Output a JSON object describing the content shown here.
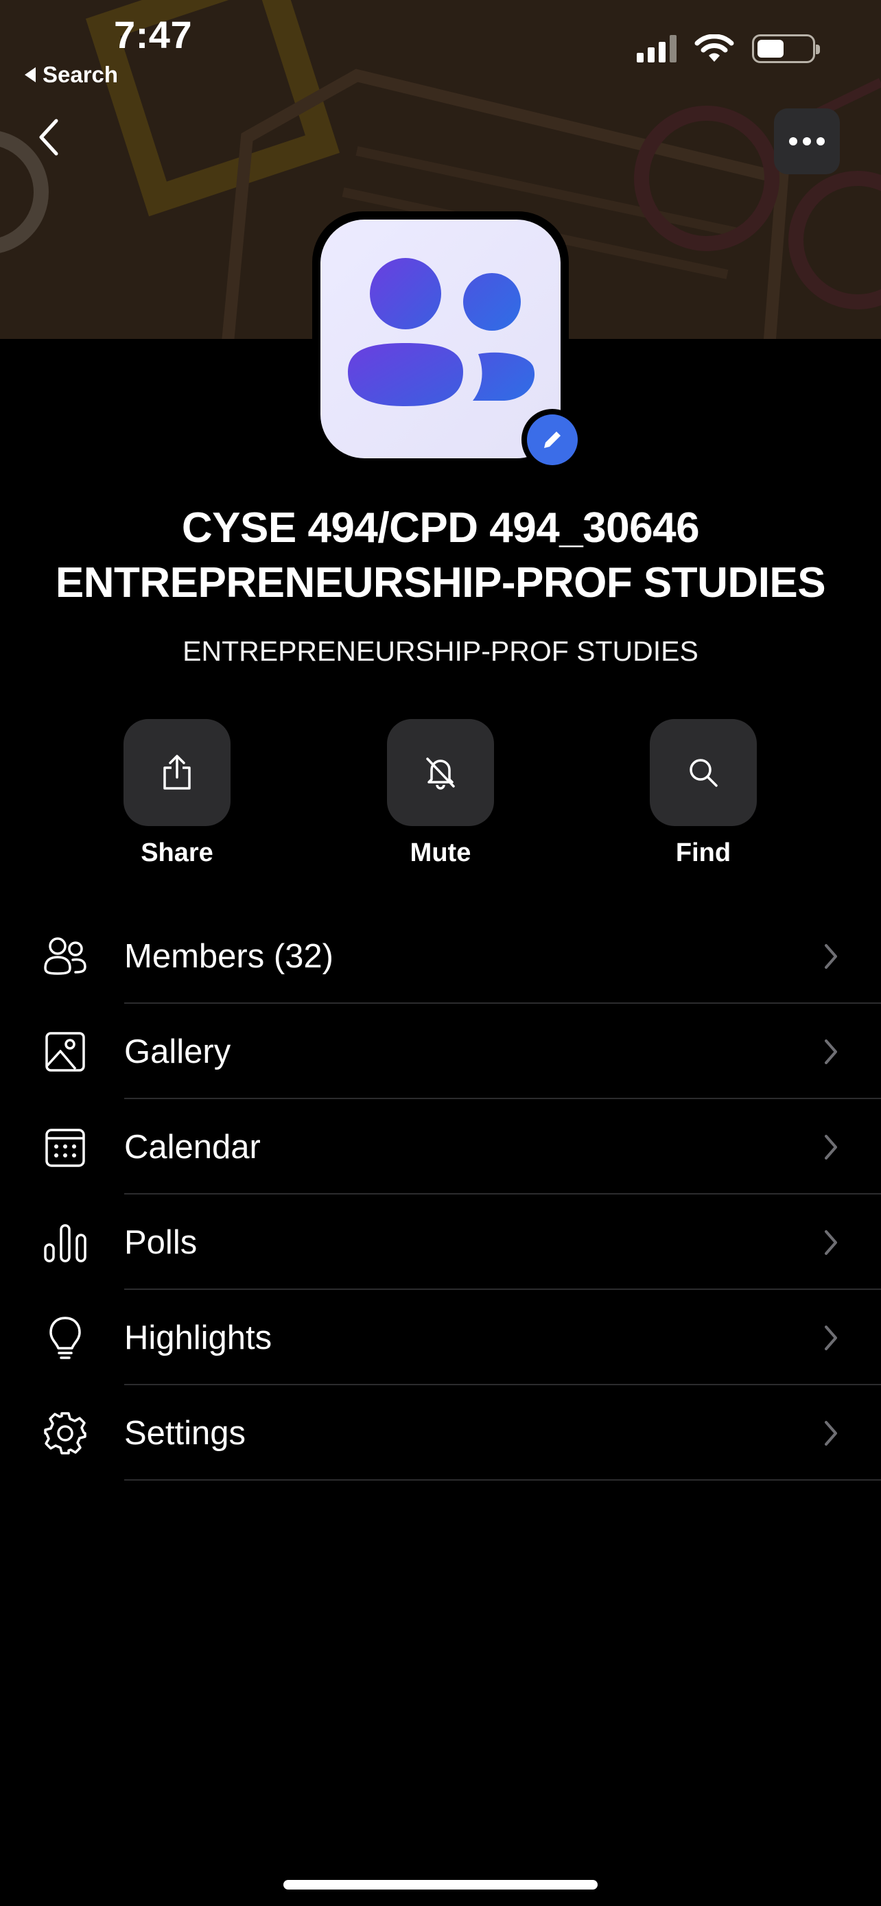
{
  "status_bar": {
    "time": "7:47",
    "back_app_label": "Search"
  },
  "header": {
    "back_icon": "chevron-left-icon",
    "more_icon": "ellipsis-icon"
  },
  "group": {
    "title": "CYSE 494/CPD 494_30646 ENTREPRENEURSHIP-PROF STUDIES",
    "subtitle": "ENTREPRENEURSHIP-PROF STUDIES",
    "avatar_icon": "group-people-icon",
    "edit_icon": "pencil-icon",
    "avatar_accent": "#3b6de8"
  },
  "actions": [
    {
      "label": "Share",
      "icon": "share-icon"
    },
    {
      "label": "Mute",
      "icon": "bell-off-icon"
    },
    {
      "label": "Find",
      "icon": "search-icon"
    }
  ],
  "menu": [
    {
      "label": "Members (32)",
      "icon": "members-icon"
    },
    {
      "label": "Gallery",
      "icon": "image-icon"
    },
    {
      "label": "Calendar",
      "icon": "calendar-icon"
    },
    {
      "label": "Polls",
      "icon": "bar-chart-icon"
    },
    {
      "label": "Highlights",
      "icon": "lightbulb-icon"
    },
    {
      "label": "Settings",
      "icon": "gear-icon"
    }
  ],
  "colors": {
    "background": "#000000",
    "button_bg": "#2c2c2e",
    "banner_bg": "#2a1f15"
  }
}
